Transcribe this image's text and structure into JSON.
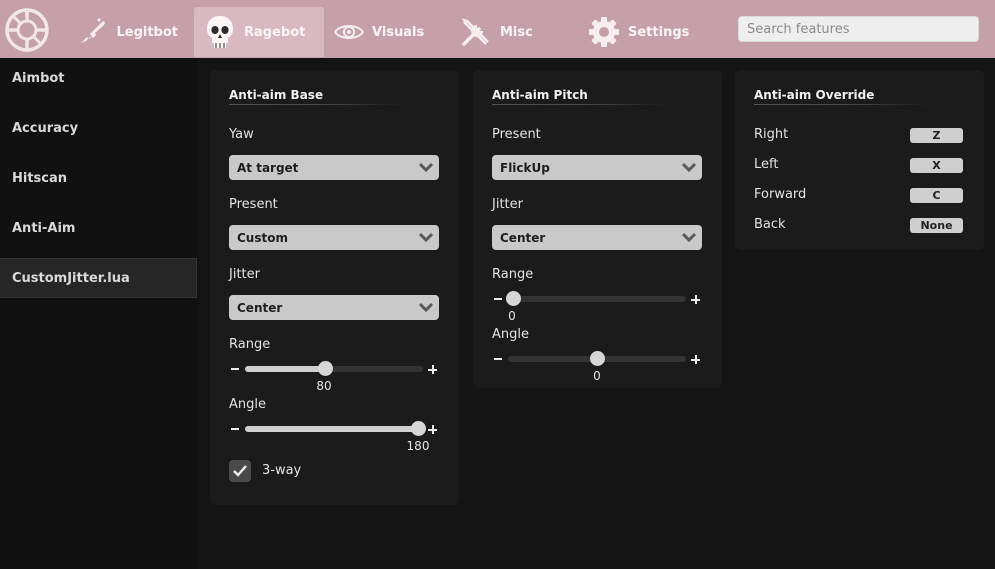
{
  "colors": {
    "topbar": "#c5a0a9",
    "active_tab": "#d8b9c1",
    "panel": "#1b1b1b",
    "sidebar": "#111111"
  },
  "nav": {
    "logo_icon": "crosshair-logo-icon",
    "tabs": [
      {
        "label": "Legitbot",
        "icon": "rifle-icon"
      },
      {
        "label": "Ragebot",
        "icon": "skull-icon",
        "active": true
      },
      {
        "label": "Visuals",
        "icon": "eye-icon"
      },
      {
        "label": "Misc",
        "icon": "tools-icon"
      },
      {
        "label": "Settings",
        "icon": "gear-icon"
      }
    ],
    "search_placeholder": "Search features"
  },
  "sidebar": {
    "items": [
      {
        "label": "Aimbot"
      },
      {
        "label": "Accuracy"
      },
      {
        "label": "Hitscan"
      },
      {
        "label": "Anti-Aim"
      },
      {
        "label": "CustomJitter.lua",
        "active": true
      }
    ]
  },
  "base": {
    "title": "Anti-aim Base",
    "yaw_label": "Yaw",
    "yaw_value": "At target",
    "present_label": "Present",
    "present_value": "Custom",
    "jitter_label": "Jitter",
    "jitter_value": "Center",
    "range_label": "Range",
    "range_value": "80",
    "range_fraction": 0.45,
    "angle_label": "Angle",
    "angle_value": "180",
    "angle_fraction": 1.0,
    "threeway_label": "3-way",
    "threeway_checked": true
  },
  "pitch": {
    "title": "Anti-aim Pitch",
    "present_label": "Present",
    "present_value": "FlickUp",
    "jitter_label": "Jitter",
    "jitter_value": "Center",
    "range_label": "Range",
    "range_value": "0",
    "range_fraction": 0.0,
    "angle_label": "Angle",
    "angle_value": "0",
    "angle_fraction": 0.5
  },
  "override": {
    "title": "Anti-aim Override",
    "rows": [
      {
        "label": "Right",
        "key": "Z"
      },
      {
        "label": "Left",
        "key": "X"
      },
      {
        "label": "Forward",
        "key": "C"
      },
      {
        "label": "Back",
        "key": "None"
      }
    ]
  }
}
